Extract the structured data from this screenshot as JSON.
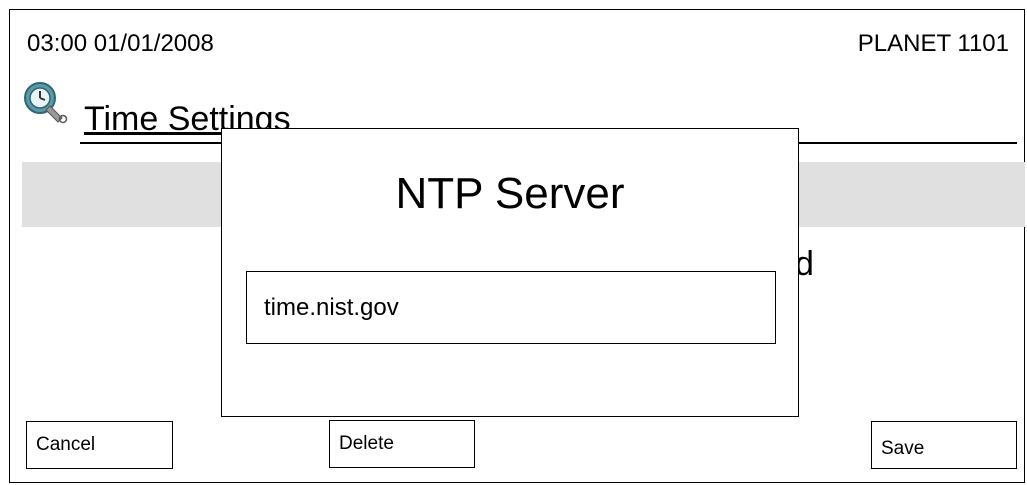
{
  "status_bar": {
    "datetime": "03:00 01/01/2008",
    "device_name": "PLANET 1101"
  },
  "page": {
    "title": "Time Settings",
    "icon": "clock-wrench-icon",
    "partial_text_behind_dialog": "d"
  },
  "dialog": {
    "title": "NTP Server",
    "input_value": "time.nist.gov"
  },
  "buttons": {
    "cancel": "Cancel",
    "delete": "Delete",
    "save": "Save"
  },
  "colors": {
    "band": "#e0e0e0",
    "border": "#000000",
    "background": "#ffffff"
  }
}
